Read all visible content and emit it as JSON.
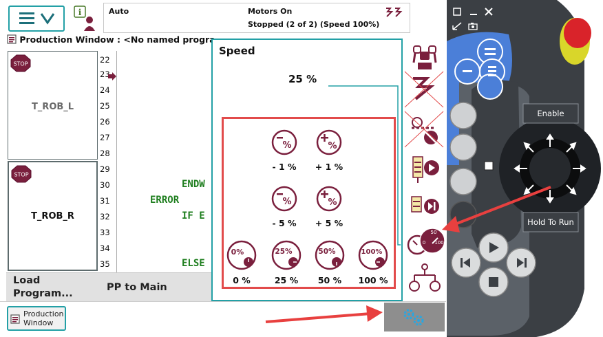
{
  "status": {
    "mode": "Auto",
    "motors": "Motors On",
    "state": "Stopped (2 of 2) (Speed 100%)"
  },
  "production": {
    "title": "Production Window : <No named progra"
  },
  "tasks": {
    "left_label": "T_ROB_L",
    "right_label": "T_ROB_R"
  },
  "line_numbers": [
    "22",
    "23",
    "24",
    "25",
    "26",
    "27",
    "28",
    "29",
    "30",
    "31",
    "32",
    "33",
    "34",
    "35"
  ],
  "code": {
    "l30": "ENDW",
    "l31": "ERROR",
    "l32": "IF E",
    "l35": "ELSE"
  },
  "bottom": {
    "load_program": "Load Program...",
    "pp_to_main": "PP to Main",
    "prod_tab": "Production Window"
  },
  "speed": {
    "title": "Speed",
    "value": "25 %",
    "buttons": {
      "minus1": "- 1 %",
      "plus1": "+ 1 %",
      "minus5": "- 5 %",
      "plus5": "+ 5 %",
      "p0": "0 %",
      "p25": "25 %",
      "p50": "50 %",
      "p100": "100 %"
    },
    "icon_text": {
      "minus": "-%",
      "plus": "+%",
      "p0": "0%",
      "p25": "25%",
      "p50": "50%",
      "p100": "100%"
    }
  },
  "speed_quick_icon": {
    "t50": "50",
    "t0": "0",
    "t100": "100"
  },
  "pendant": {
    "enable": "Enable",
    "hold_to_run": "Hold To Run"
  },
  "colors": {
    "accent_teal": "#23a0a6",
    "icon_maroon": "#7a1f3d",
    "highlight_red": "#e24b4b",
    "pendant_blue": "#4b7fd8",
    "pendant_dark": "#3b3f44"
  }
}
